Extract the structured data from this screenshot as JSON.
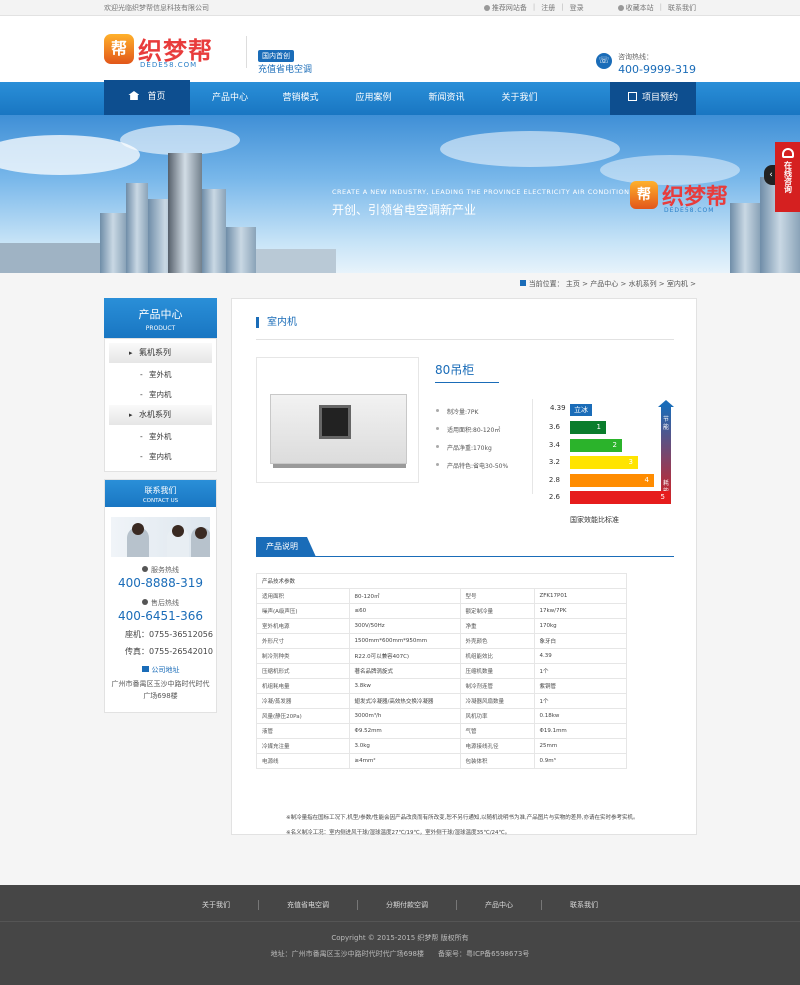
{
  "topbar": {
    "welcome": "欢迎光临织梦帮信息科技有限公司",
    "links": [
      "推荐网站备",
      "注册",
      "登录"
    ],
    "right_links": [
      "收藏本站",
      "联系我们"
    ]
  },
  "header": {
    "logo_text": "织梦帮",
    "logo_sub": "DEDE58.COM",
    "logo_badge": "帮",
    "tag": "国内首创",
    "slogan": "充值省电空调",
    "hotline_label": "咨询热线：",
    "hotline": "400-9999-319"
  },
  "nav": {
    "home": "首页",
    "items": [
      "产品中心",
      "营销模式",
      "应用案例",
      "新闻资讯",
      "关于我们"
    ],
    "appoint": "项目预约"
  },
  "banner": {
    "en": "CREATE A NEW INDUSTRY, LEADING THE PROVINCE ELECTRICITY AIR CONDITIONING",
    "cn": "开创、引领省电空调新产业",
    "logo_text": "织梦帮",
    "logo_sub": "DEDE58.COM",
    "logo_badge": "帮",
    "arrow": "‹"
  },
  "consult": {
    "label": "在线咨询"
  },
  "breadcrumb": {
    "label": "当前位置：",
    "items": [
      "主页",
      "产品中心",
      "水机系列",
      "室内机"
    ]
  },
  "sidebar": {
    "title": "产品中心",
    "title_en": "PRODUCT",
    "groups": [
      {
        "name": "氟机系列",
        "items": [
          "室外机",
          "室内机"
        ]
      },
      {
        "name": "水机系列",
        "items": [
          "室外机",
          "室内机"
        ]
      }
    ]
  },
  "contact": {
    "title": "联系我们",
    "title_en": "CONTACT US",
    "service_label": "服务热线",
    "service": "400-8888-319",
    "after_label": "售后热线",
    "after": "400-6451-366",
    "phone": "座机：0755-36512056",
    "fax": "传真：0755-26542010",
    "addr_label": "公司地址",
    "addr": "广州市番禺区玉沙中路时代时代广场698楼"
  },
  "main": {
    "title": "室内机",
    "product_name": "80吊柜",
    "specs": [
      "制冷量:7PK",
      "适用面积:80-120㎡",
      "产品净重:170kg",
      "产品特色:省电30-50%"
    ],
    "section_tab": "产品说明",
    "table_title": "产品技术参数",
    "table": [
      [
        "适用面积",
        "80-120㎡",
        "型号",
        "ZFK17P01"
      ],
      [
        "噪声(A级声压)",
        "≤60",
        "额定制冷量",
        "17kw/7PK"
      ],
      [
        "室外机电源",
        "300V/50Hz",
        "净重",
        "170kg"
      ],
      [
        "外形尺寸",
        "1500mm*600mm*950mm",
        "外壳颜色",
        "象牙白"
      ],
      [
        "制冷剂种类",
        "R22.0可以兼容407C)",
        "机组能效比",
        "4.39"
      ],
      [
        "压缩机形式",
        "著名品牌涡旋式",
        "压缩机数量",
        "1个"
      ],
      [
        "机组耗电量",
        "3.8kw",
        "制冷剂连管",
        "紫铜管"
      ],
      [
        "冷凝/蒸发器",
        "翅发式冷凝器/高效热交换冷凝器",
        "冷凝器风扇数量",
        "1个"
      ],
      [
        "风量(静压20Pa)",
        "3000m³/h",
        "风机功率",
        "0.18kw"
      ],
      [
        "液管",
        "Φ9.52mm",
        "气管",
        "Φ19.1mm"
      ],
      [
        "冷媒充注量",
        "3.0kg",
        "电源接线孔径",
        "25mm"
      ],
      [
        "电源线",
        "≥4mm²",
        "包装体积",
        "0.9m³"
      ]
    ],
    "notes": [
      "※制冷量指在国标工况下,机型/参数/性能会因产品改良而有所改变,恕不另行通知,以随机说明书为准,产品图片与实物的差异,亦请在实时参考实机。",
      "※名义制冷工况：室内侧进风干球/湿球温度27℃/19℃，室外侧干球/湿球温度35℃/24℃。"
    ]
  },
  "chart_data": {
    "type": "bar",
    "title": "",
    "xlabel": "国家效能比标准",
    "top_value": "4.39",
    "top_label": "立冰",
    "categories": [
      "3.6",
      "3.4",
      "3.2",
      "2.8",
      "2.6"
    ],
    "levels": [
      "1",
      "2",
      "3",
      "4",
      "5"
    ],
    "values": [
      1,
      2,
      3,
      4,
      5
    ],
    "colors": [
      "#0a7d2c",
      "#2bb32b",
      "#ffe400",
      "#ff8c00",
      "#e61c1c"
    ],
    "arrow_top": "节能",
    "arrow_bottom": "耗能"
  },
  "footer": {
    "links": [
      "关于我们",
      "充值省电空调",
      "分期付款空调",
      "产品中心",
      "联系我们"
    ],
    "copyright": "Copyright © 2015-2015 织梦帮 版权所有",
    "address": "地址：广州市番禺区玉沙中路时代时代广场698楼　　备案号：粤ICP备6598673号"
  },
  "colors": {
    "brand_blue": "#1a6cb8",
    "brand_red": "#e83c3c",
    "footer_bg": "#464646"
  }
}
